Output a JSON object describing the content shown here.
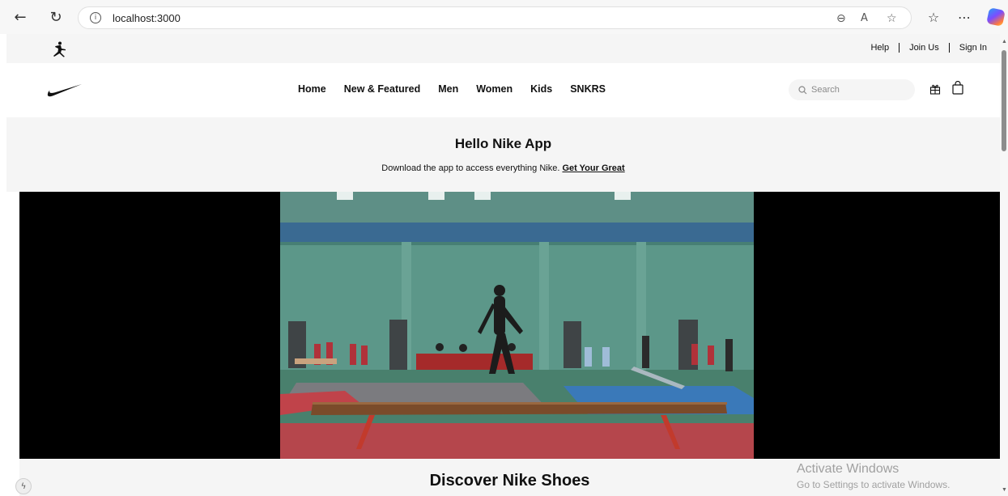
{
  "browser": {
    "url": "localhost:3000",
    "back_icon": "back-arrow-icon",
    "refresh_icon": "refresh-icon"
  },
  "topbar": {
    "links": [
      "Help",
      "Join Us",
      "Sign In"
    ]
  },
  "nav": {
    "items": [
      "Home",
      "New & Featured",
      "Men",
      "Women",
      "Kids",
      "SNKRS"
    ],
    "search_placeholder": "Search"
  },
  "promo": {
    "title": "Hello Nike App",
    "text": "Download the app to access everything Nike.",
    "link": "Get Your Great"
  },
  "section": {
    "title": "Discover Nike Shoes"
  },
  "watermark": {
    "title": "Activate Windows",
    "subtitle": "Go to Settings to activate Windows."
  },
  "colors": {
    "page_bg": "#ffffff",
    "band_bg": "#f5f5f5",
    "text": "#111111",
    "video_bg": "#000000"
  }
}
